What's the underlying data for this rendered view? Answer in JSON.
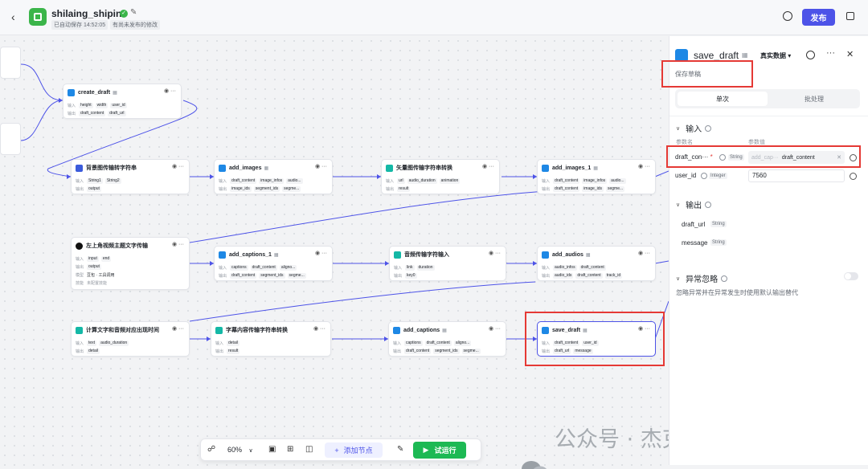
{
  "header": {
    "app_name": "shilaing_shipin",
    "save_status": "已自动保存 14:52:05",
    "publish_status": "有尚未发布的修改",
    "publish_label": "发布"
  },
  "row_labels": {
    "in": "输入",
    "out": "输出",
    "skill": "技能",
    "skill2": "未配置技能"
  },
  "nodes": {
    "create_draft": {
      "title": "create_draft",
      "in": [
        "height",
        "width",
        "user_id"
      ],
      "out": [
        "draft_content",
        "draft_url"
      ]
    },
    "bg_image": {
      "title": "背景图传输转字符串",
      "in": [
        "String1",
        "String2"
      ],
      "out": [
        "output"
      ]
    },
    "add_images": {
      "title": "add_images",
      "in": [
        "draft_content",
        "image_infos",
        "audio..."
      ],
      "out": [
        "image_ids",
        "segment_ids",
        "segme..."
      ]
    },
    "vector_img": {
      "title": "矢量图传输字符串转换",
      "in": [
        "url",
        "audio_duration",
        "animation"
      ],
      "out": [
        "result"
      ]
    },
    "add_images_1": {
      "title": "add_images_1",
      "in": [
        "draft_content",
        "image_infos",
        "audio..."
      ],
      "out": [
        "draft_content",
        "image_ids",
        "segme..."
      ]
    },
    "top_left_text": {
      "title": "左上角视频主题文字传输",
      "in": [
        "input",
        "end"
      ],
      "out": [
        "output"
      ],
      "skill": "豆包 · 工具调用",
      "skill2": "未配置技能"
    },
    "add_captions_1": {
      "title": "add_captions_1",
      "in": [
        "captions",
        "draft_content",
        "aligno..."
      ],
      "out": [
        "draft_content",
        "segment_ids",
        "segme..."
      ]
    },
    "audio_str": {
      "title": "音频传输字符输入",
      "in": [
        "link",
        "duration"
      ],
      "out": [
        "key0"
      ]
    },
    "add_audios": {
      "title": "add_audios",
      "in": [
        "audio_infos",
        "draft_content"
      ],
      "out": [
        "audio_ids",
        "draft_content",
        "track_id"
      ]
    },
    "calc_time": {
      "title": "计算文字和音频对应出现时间",
      "in": [
        "text",
        "audio_duration"
      ],
      "out": [
        "detail"
      ]
    },
    "caption_str": {
      "title": "字幕内容传输字符串转换",
      "in": [
        "detail"
      ],
      "out": [
        "result"
      ]
    },
    "add_captions": {
      "title": "add_captions",
      "in": [
        "captions",
        "draft_content",
        "aligno..."
      ],
      "out": [
        "draft_content",
        "segment_ids",
        "segme..."
      ]
    },
    "save_draft": {
      "title": "save_draft",
      "in": [
        "draft_content",
        "user_id"
      ],
      "out": [
        "draft_url",
        "message"
      ]
    }
  },
  "toolbar": {
    "zoom": "60%",
    "add_node": "添加节点",
    "run": "试运行"
  },
  "watermark": "公众号 · 杰克船长的AIGC",
  "panel": {
    "title": "save_draft",
    "mode": "真实数据 ▾",
    "description": "保存草稿",
    "tab_single": "单次",
    "tab_batch": "批处理",
    "input_section": "输入",
    "col_name": "参数名",
    "col_value": "参数值",
    "params": [
      {
        "name": "draft_con···",
        "type": "String",
        "placeholder": "add_cap···",
        "value": "draft_content"
      },
      {
        "name": "user_id",
        "type": "Integer",
        "value": "7560"
      }
    ],
    "output_section": "输出",
    "outputs": [
      {
        "name": "draft_url",
        "type": "String"
      },
      {
        "name": "message",
        "type": "String"
      }
    ],
    "exception_section": "异常忽略",
    "exception_desc": "忽略异常并在异常发生时使用默认输出替代"
  }
}
